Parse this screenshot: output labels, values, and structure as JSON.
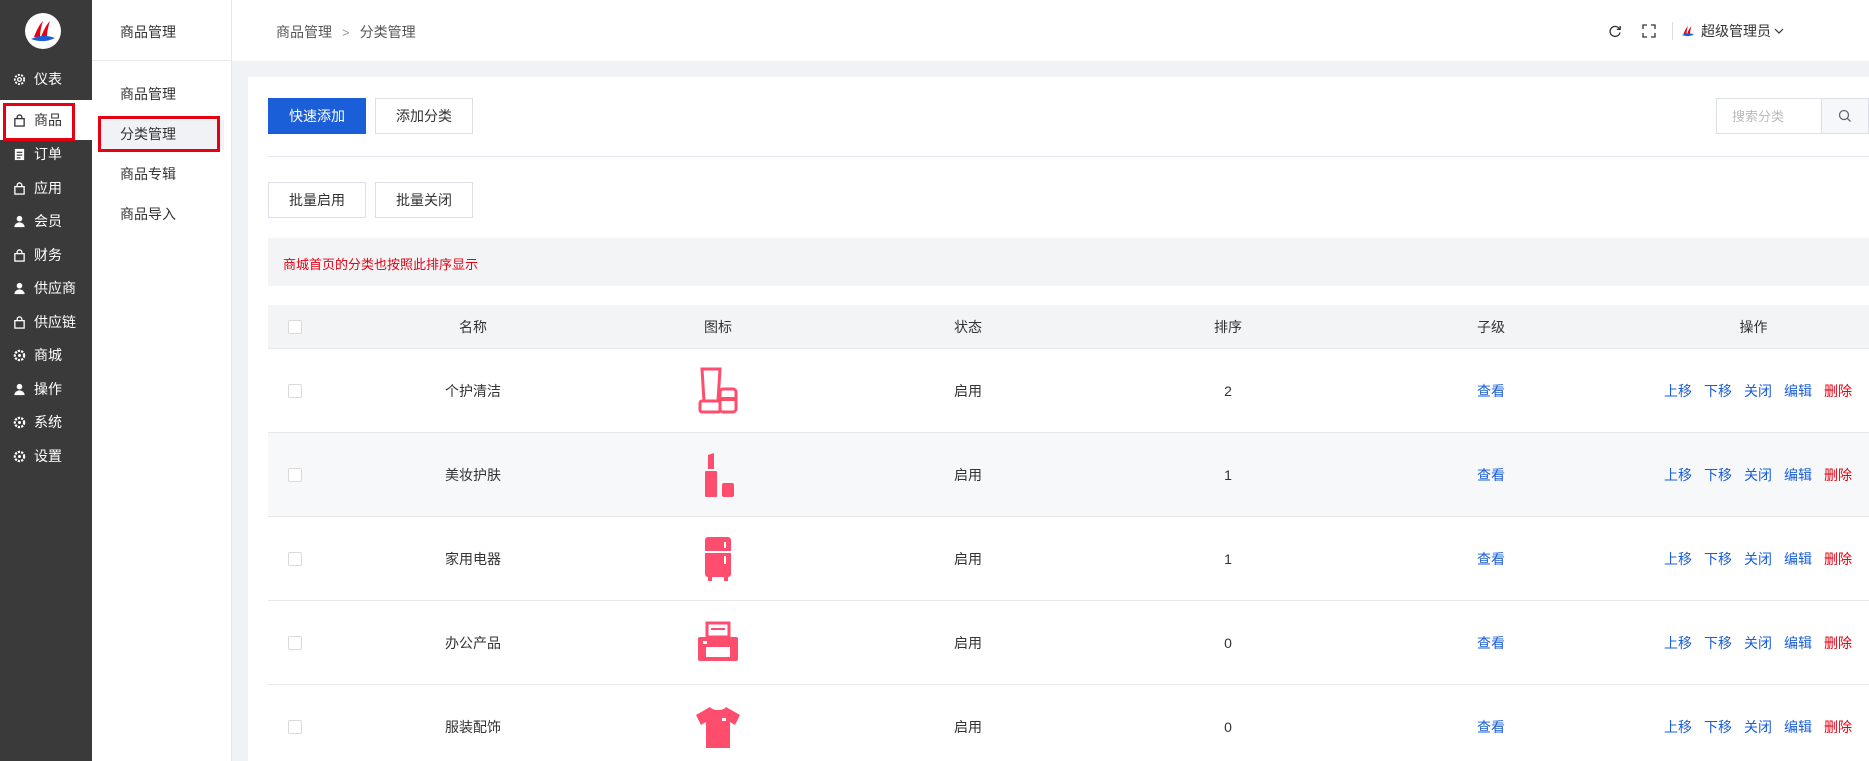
{
  "colors": {
    "accent": "#1a5fd8",
    "danger": "#e60012",
    "sidebar": "#3a3a3a",
    "category_icon": "#ff4d6d"
  },
  "sidebar": {
    "items": [
      {
        "label": "仪表",
        "icon": "gear-icon"
      },
      {
        "label": "商品",
        "icon": "bag-icon"
      },
      {
        "label": "订单",
        "icon": "clipboard-icon"
      },
      {
        "label": "应用",
        "icon": "bag-icon"
      },
      {
        "label": "会员",
        "icon": "person-icon"
      },
      {
        "label": "财务",
        "icon": "bag-icon"
      },
      {
        "label": "供应商",
        "icon": "person-icon"
      },
      {
        "label": "供应链",
        "icon": "bag-icon"
      },
      {
        "label": "商城",
        "icon": "gear-icon"
      },
      {
        "label": "操作",
        "icon": "person-icon"
      },
      {
        "label": "系统",
        "icon": "gear-icon"
      },
      {
        "label": "设置",
        "icon": "gear-icon"
      }
    ]
  },
  "subnav": {
    "title": "商品管理",
    "items": [
      {
        "label": "商品管理"
      },
      {
        "label": "分类管理"
      },
      {
        "label": "商品专辑"
      },
      {
        "label": "商品导入"
      }
    ]
  },
  "header": {
    "breadcrumb": [
      "商品管理",
      "分类管理"
    ],
    "breadcrumb_separator": ">",
    "user_name": "超级管理员"
  },
  "toolbar": {
    "quick_add": "快速添加",
    "add_category": "添加分类",
    "search_placeholder": "搜索分类",
    "batch_enable": "批量启用",
    "batch_disable": "批量关闭"
  },
  "notice": "商城首页的分类也按照此排序显示",
  "table": {
    "columns": [
      "名称",
      "图标",
      "状态",
      "排序",
      "子级",
      "操作"
    ],
    "actions": [
      "上移",
      "下移",
      "关闭",
      "编辑",
      "删除"
    ],
    "rows": [
      {
        "name": "个护清洁",
        "icon": "personal-care-icon",
        "status": "启用",
        "sort": "2",
        "child": "查看"
      },
      {
        "name": "美妆护肤",
        "icon": "cosmetics-icon",
        "status": "启用",
        "sort": "1",
        "child": "查看"
      },
      {
        "name": "家用电器",
        "icon": "refrigerator-icon",
        "status": "启用",
        "sort": "1",
        "child": "查看"
      },
      {
        "name": "办公产品",
        "icon": "printer-icon",
        "status": "启用",
        "sort": "0",
        "child": "查看"
      },
      {
        "name": "服装配饰",
        "icon": "tshirt-icon",
        "status": "启用",
        "sort": "0",
        "child": "查看"
      }
    ]
  }
}
